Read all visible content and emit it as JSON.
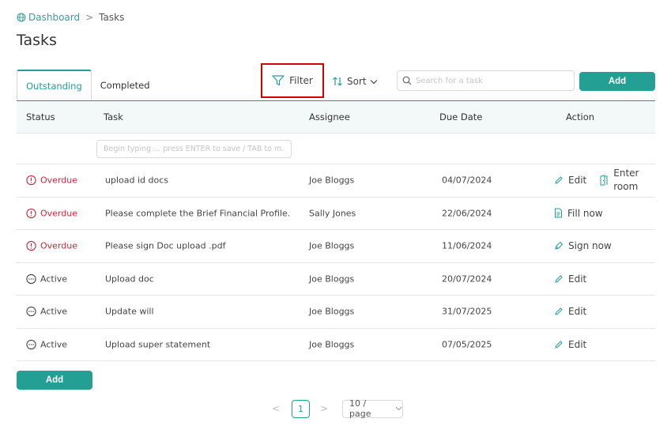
{
  "breadcrumb": {
    "home": "Dashboard",
    "separator": ">",
    "current": "Tasks"
  },
  "page_title": "Tasks",
  "tabs": [
    {
      "label": "Outstanding",
      "active": true
    },
    {
      "label": "Completed",
      "active": false
    }
  ],
  "toolbar": {
    "filter_label": "Filter",
    "sort_label": "Sort",
    "search_placeholder": "Search for a task",
    "add_label": "Add"
  },
  "table": {
    "columns": [
      "Status",
      "Task",
      "Assignee",
      "Due Date",
      "Action"
    ],
    "new_task_placeholder": "Begin typing ... press ENTER to save / TAB to m...",
    "rows": [
      {
        "status": "Overdue",
        "task": "upload id docs",
        "assignee": "Joe Bloggs",
        "due": "04/07/2024",
        "actions": [
          "Edit",
          "Enter room"
        ]
      },
      {
        "status": "Overdue",
        "task": "Please complete the Brief Financial Profile.",
        "assignee": "Sally Jones",
        "due": "22/06/2024",
        "actions": [
          "Fill now"
        ]
      },
      {
        "status": "Overdue",
        "task": "Please sign Doc upload .pdf",
        "assignee": "Joe Bloggs",
        "due": "11/06/2024",
        "actions": [
          "Sign now"
        ]
      },
      {
        "status": "Active",
        "task": "Upload doc",
        "assignee": "Joe Bloggs",
        "due": "20/07/2024",
        "actions": [
          "Edit"
        ]
      },
      {
        "status": "Active",
        "task": "Update will",
        "assignee": "Joe Bloggs",
        "due": "31/07/2025",
        "actions": [
          "Edit"
        ]
      },
      {
        "status": "Active",
        "task": "Upload super statement",
        "assignee": "Joe Bloggs",
        "due": "07/05/2025",
        "actions": [
          "Edit"
        ]
      }
    ]
  },
  "bottom_add_label": "Add",
  "pagination": {
    "prev": "<",
    "current_page": "1",
    "next": ">",
    "page_size": "10 / page"
  },
  "colors": {
    "accent": "#23a093",
    "overdue": "#c8283a",
    "highlight": "#d40000"
  }
}
